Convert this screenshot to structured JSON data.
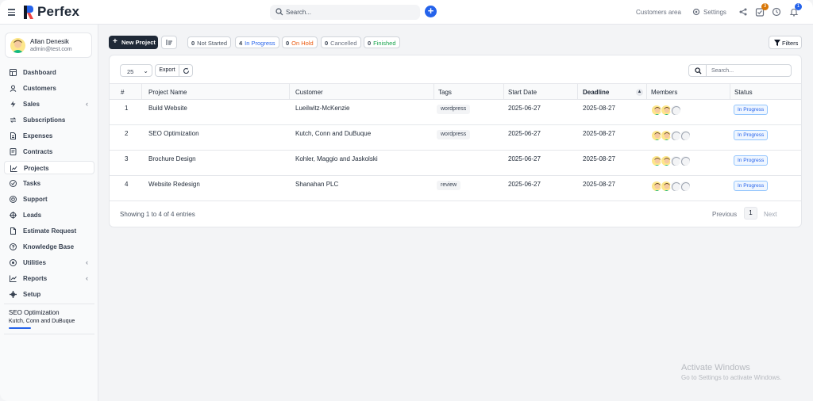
{
  "app": {
    "brand": "Perfex",
    "brand_colors": {
      "logo_left": "#111827",
      "logo_right": "#2563eb",
      "logo_accent": "#ef4444"
    }
  },
  "topbar": {
    "search_placeholder": "Search...",
    "customers_area": "Customers area",
    "settings": "Settings",
    "tasks_badge": "3",
    "notifications_badge": "1"
  },
  "user": {
    "name": "Allan Denesik",
    "email": "admin@test.com"
  },
  "sidebar": {
    "items": [
      {
        "label": "Dashboard",
        "icon": "dashboard-icon",
        "chevron": false
      },
      {
        "label": "Customers",
        "icon": "user-icon",
        "chevron": false
      },
      {
        "label": "Sales",
        "icon": "bolt-icon",
        "chevron": true
      },
      {
        "label": "Subscriptions",
        "icon": "refresh-icon",
        "chevron": false
      },
      {
        "label": "Expenses",
        "icon": "file-icon",
        "chevron": false
      },
      {
        "label": "Contracts",
        "icon": "contract-icon",
        "chevron": false
      },
      {
        "label": "Projects",
        "icon": "chart-icon",
        "chevron": false,
        "active": true
      },
      {
        "label": "Tasks",
        "icon": "check-circle-icon",
        "chevron": false
      },
      {
        "label": "Support",
        "icon": "lifebuoy-icon",
        "chevron": false
      },
      {
        "label": "Leads",
        "icon": "crosshair-icon",
        "chevron": false
      },
      {
        "label": "Estimate Request",
        "icon": "document-icon",
        "chevron": false
      },
      {
        "label": "Knowledge Base",
        "icon": "question-circle-icon",
        "chevron": false
      },
      {
        "label": "Utilities",
        "icon": "target-icon",
        "chevron": true
      },
      {
        "label": "Reports",
        "icon": "line-chart-icon",
        "chevron": true
      },
      {
        "label": "Setup",
        "icon": "gear-icon",
        "chevron": false
      }
    ],
    "pinned_project": {
      "title": "SEO Optimization",
      "customer": "Kutch, Conn and DuBuque"
    }
  },
  "toolbar": {
    "new_project": "New Project",
    "filters": "Filters",
    "status_filters": [
      {
        "count": "0",
        "label": "Not Started",
        "color": "#4b5563"
      },
      {
        "count": "4",
        "label": "In Progress",
        "color": "#2563eb"
      },
      {
        "count": "0",
        "label": "On Hold",
        "color": "#ea580c"
      },
      {
        "count": "0",
        "label": "Cancelled",
        "color": "#6b7280"
      },
      {
        "count": "0",
        "label": "Finished",
        "color": "#16a34a"
      }
    ]
  },
  "table": {
    "page_length": "25",
    "export": "Export",
    "search_placeholder": "Search...",
    "columns": [
      "#",
      "Project Name",
      "Customer",
      "Tags",
      "Start Date",
      "Deadline",
      "Members",
      "Status"
    ],
    "rows": [
      {
        "id": "1",
        "name": "Build Website",
        "customer": "Lueilwitz-McKenzie",
        "tag": "wordpress",
        "start": "2025-06-27",
        "deadline": "2025-08-27",
        "members": 3,
        "status": "In Progress"
      },
      {
        "id": "2",
        "name": "SEO Optimization",
        "customer": "Kutch, Conn and DuBuque",
        "tag": "wordpress",
        "start": "2025-06-27",
        "deadline": "2025-08-27",
        "members": 4,
        "status": "In Progress"
      },
      {
        "id": "3",
        "name": "Brochure Design",
        "customer": "Kohler, Maggio and Jaskolski",
        "tag": "",
        "start": "2025-06-27",
        "deadline": "2025-08-27",
        "members": 4,
        "status": "In Progress"
      },
      {
        "id": "4",
        "name": "Website Redesign",
        "customer": "Shanahan PLC",
        "tag": "review",
        "start": "2025-06-27",
        "deadline": "2025-08-27",
        "members": 4,
        "status": "In Progress"
      }
    ],
    "info": "Showing 1 to 4 of 4 entries",
    "pagination": {
      "previous": "Previous",
      "current": "1",
      "next": "Next"
    }
  },
  "watermark": {
    "title": "Activate Windows",
    "subtitle": "Go to Settings to activate Windows."
  }
}
